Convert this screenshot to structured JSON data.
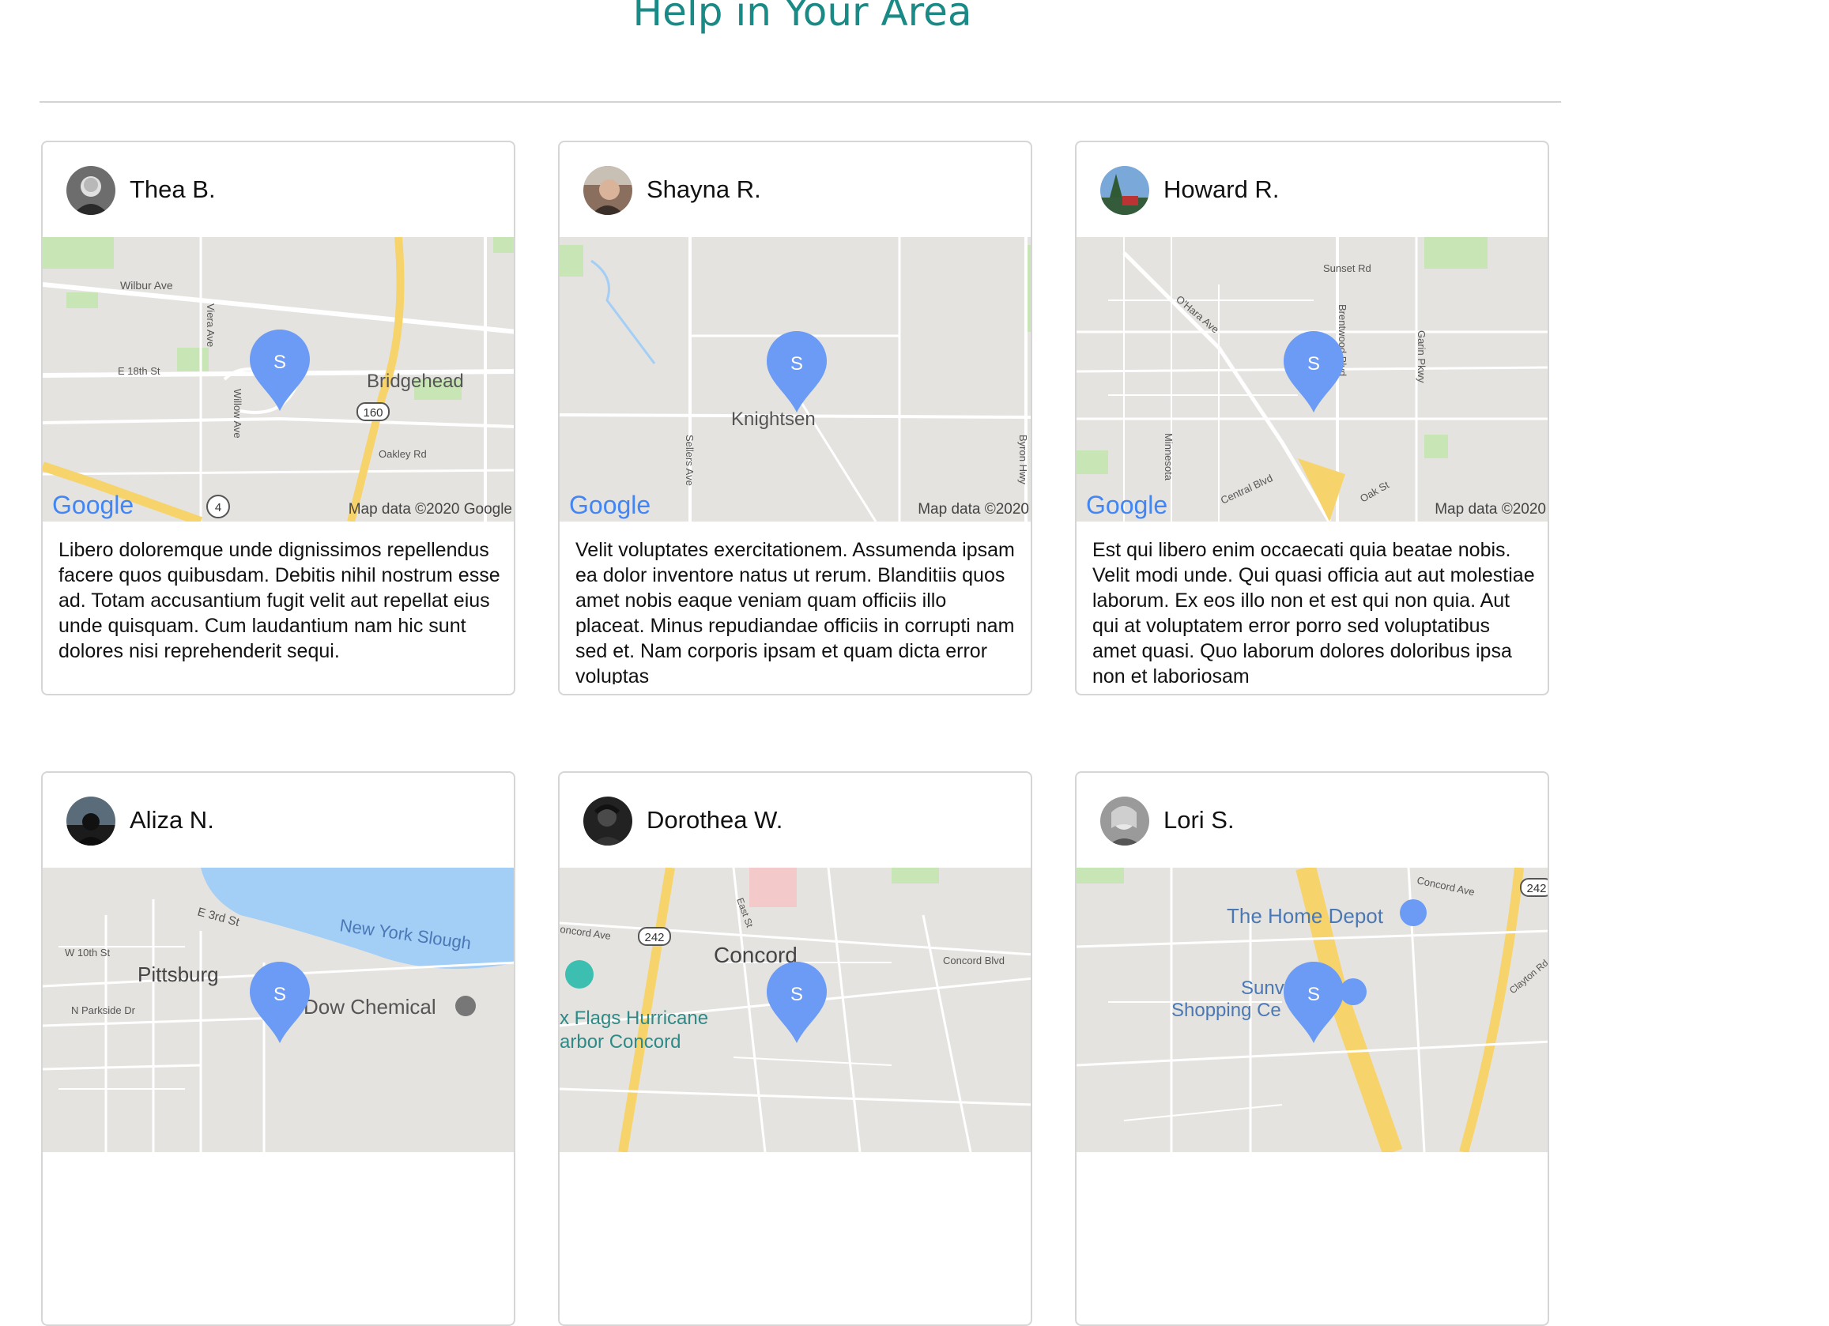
{
  "page": {
    "title": "Help in Your Area"
  },
  "colors": {
    "title": "#1a8a87",
    "map_bg": "#e5e3df",
    "road_major": "#f7d36b",
    "water": "#a3cef6",
    "park": "#c8e6b5",
    "pin": "#6b9bf5"
  },
  "cards": [
    {
      "name": "Thea B.",
      "avatar_icon": "person-avatar",
      "map": {
        "labels": [
          "Wilbur Ave",
          "Viera Ave",
          "E 18th St",
          "Bridgehead",
          "160",
          "Willow Ave",
          "Oakley Rd",
          "4"
        ],
        "logo": "Google",
        "attribution": "Map data ©2020 Google",
        "pin_label": "S"
      },
      "text": "Libero doloremque unde dignissimos repellendus facere quos quibusdam. Debitis nihil nostrum esse ad. Totam accusantium fugit velit aut repellat eius unde quisquam. Cum laudantium nam hic sunt dolores nisi reprehenderit sequi."
    },
    {
      "name": "Shayna R.",
      "avatar_icon": "person-avatar",
      "map": {
        "labels": [
          "Knightsen",
          "Sellers Ave",
          "Byron Hwy"
        ],
        "logo": "Google",
        "attribution": "Map data ©2020",
        "pin_label": "S"
      },
      "text": "Velit voluptates exercitationem. Assumenda ipsam ea dolor inventore natus ut rerum. Blanditiis quos amet nobis eaque veniam quam officiis illo placeat. Minus repudiandae officiis in corrupti nam sed et. Nam corporis ipsam et quam dicta error voluptas"
    },
    {
      "name": "Howard R.",
      "avatar_icon": "person-avatar",
      "map": {
        "labels": [
          "Sunset Rd",
          "O'Hara Ave",
          "Brentwood Blvd",
          "Garin Pkwy",
          "Minnesota",
          "Central Blvd",
          "Oak St"
        ],
        "logo": "Google",
        "attribution": "Map data ©2020",
        "pin_label": "S"
      },
      "text": "Est qui libero enim occaecati quia beatae nobis. Velit modi unde. Qui quasi officia aut aut molestiae laborum. Ex eos illo non et est qui non quia. Aut qui at voluptatem error porro sed voluptatibus amet quasi. Quo laborum dolores doloribus ipsa non et laboriosam"
    },
    {
      "name": "Aliza N.",
      "avatar_icon": "person-avatar",
      "map": {
        "labels": [
          "E 3rd St",
          "New York Slough",
          "W 10th St",
          "Pittsburg",
          "N Parkside Dr",
          "Dow Chemical"
        ],
        "pin_label": "S"
      },
      "text": ""
    },
    {
      "name": "Dorothea W.",
      "avatar_icon": "person-avatar",
      "map": {
        "labels": [
          "East St",
          "oncord Ave",
          "242",
          "Concord",
          "Concord Blvd",
          "x Flags Hurricane",
          "arbor Concord"
        ],
        "pin_label": "S"
      },
      "text": ""
    },
    {
      "name": "Lori S.",
      "avatar_icon": "person-avatar",
      "map": {
        "labels": [
          "Concord Ave",
          "242",
          "The Home Depot",
          "Sunvalley",
          "Shopping Ce",
          "Clayton Rd"
        ],
        "pin_label": "S"
      },
      "text": ""
    }
  ]
}
